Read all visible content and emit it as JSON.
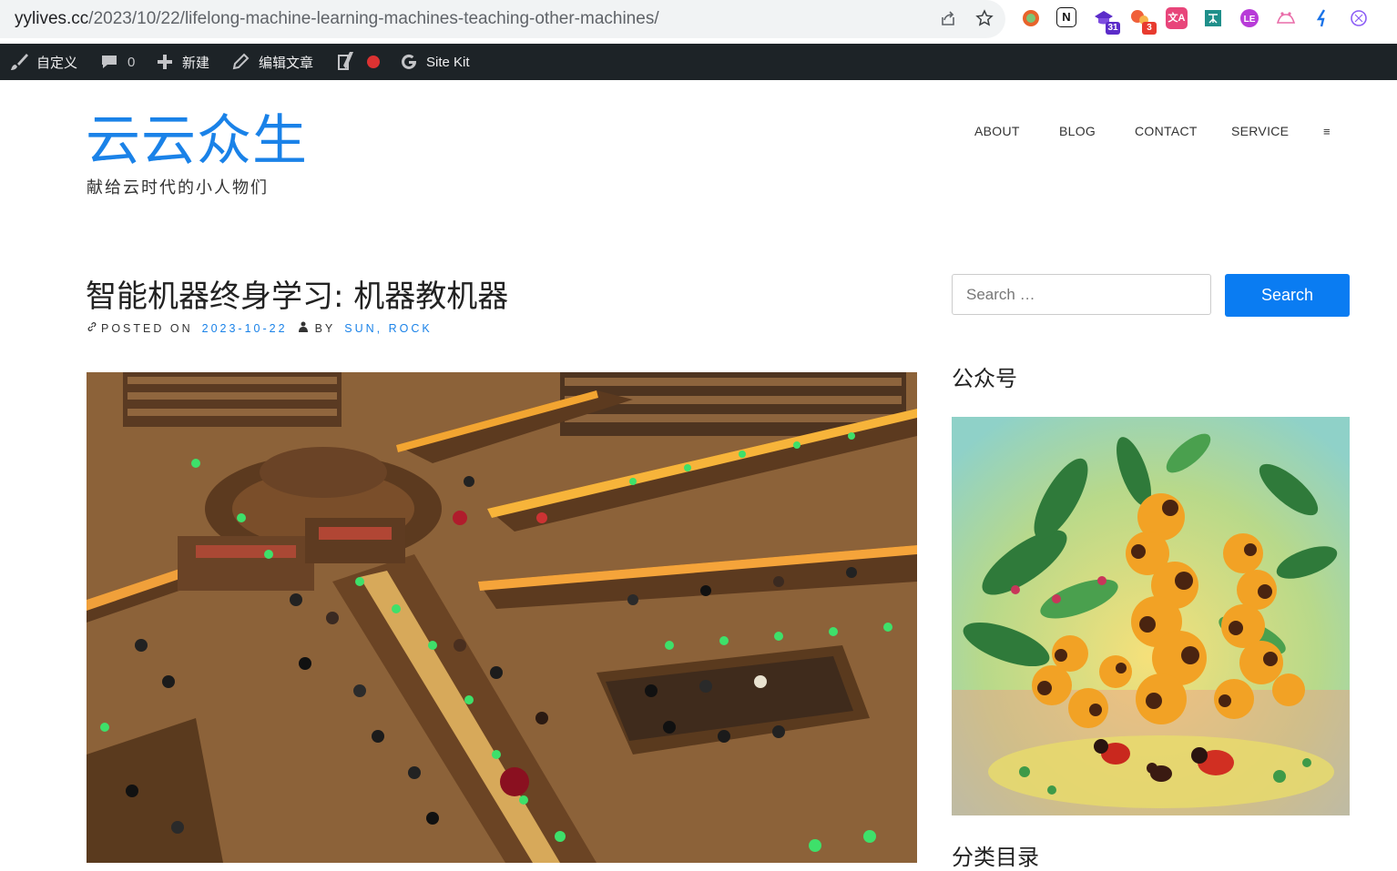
{
  "browser": {
    "url_host": "yylives.cc",
    "url_path": "/2023/10/22/lifelong-machine-learning-machines-teaching-other-machines/",
    "extensions": [
      {
        "name": "extension-orange-ring",
        "label": "",
        "color": "#e8632b"
      },
      {
        "name": "extension-notion",
        "label": "N",
        "color": "#111111"
      },
      {
        "name": "extension-purple-hat",
        "label": "",
        "color": "#5b2cc9",
        "badge": "31"
      },
      {
        "name": "extension-red-blobs",
        "label": "",
        "color": "#e83b2f",
        "badge": "3"
      },
      {
        "name": "extension-translate",
        "label": "文A",
        "color": "#e8457a"
      },
      {
        "name": "extension-teal-box",
        "label": "",
        "color": "#1f8f8a"
      },
      {
        "name": "extension-purple-circle",
        "label": "",
        "color": "#b83bd8"
      },
      {
        "name": "extension-pink-crown",
        "label": "",
        "color": "#e96ba8"
      },
      {
        "name": "extension-blue-arrow",
        "label": "",
        "color": "#1a73e8"
      },
      {
        "name": "extension-openai",
        "label": "",
        "color": "#8b5cf6"
      }
    ]
  },
  "adminbar": {
    "customize": "自定义",
    "comments_count": "0",
    "new": "新建",
    "edit": "编辑文章",
    "sitekit": "Site Kit"
  },
  "site": {
    "title": "云云众生",
    "tagline": "献给云时代的小人物们"
  },
  "nav": {
    "items": [
      "ABOUT",
      "BLOG",
      "CONTACT",
      "SERVICE"
    ],
    "menu_icon": "≡"
  },
  "post": {
    "title": "智能机器终身学习: 机器教机器",
    "posted_on_label": "POSTED ON",
    "date": "2023-10-22",
    "by_label": "BY",
    "author": "SUN, ROCK"
  },
  "sidebar": {
    "search_placeholder": "Search …",
    "search_button": "Search",
    "widget1_title": "公众号",
    "widget2_title": "分类目录"
  },
  "colors": {
    "accent": "#1a82e8",
    "button": "#0a7cf2",
    "adminbar": "#1d2327"
  }
}
